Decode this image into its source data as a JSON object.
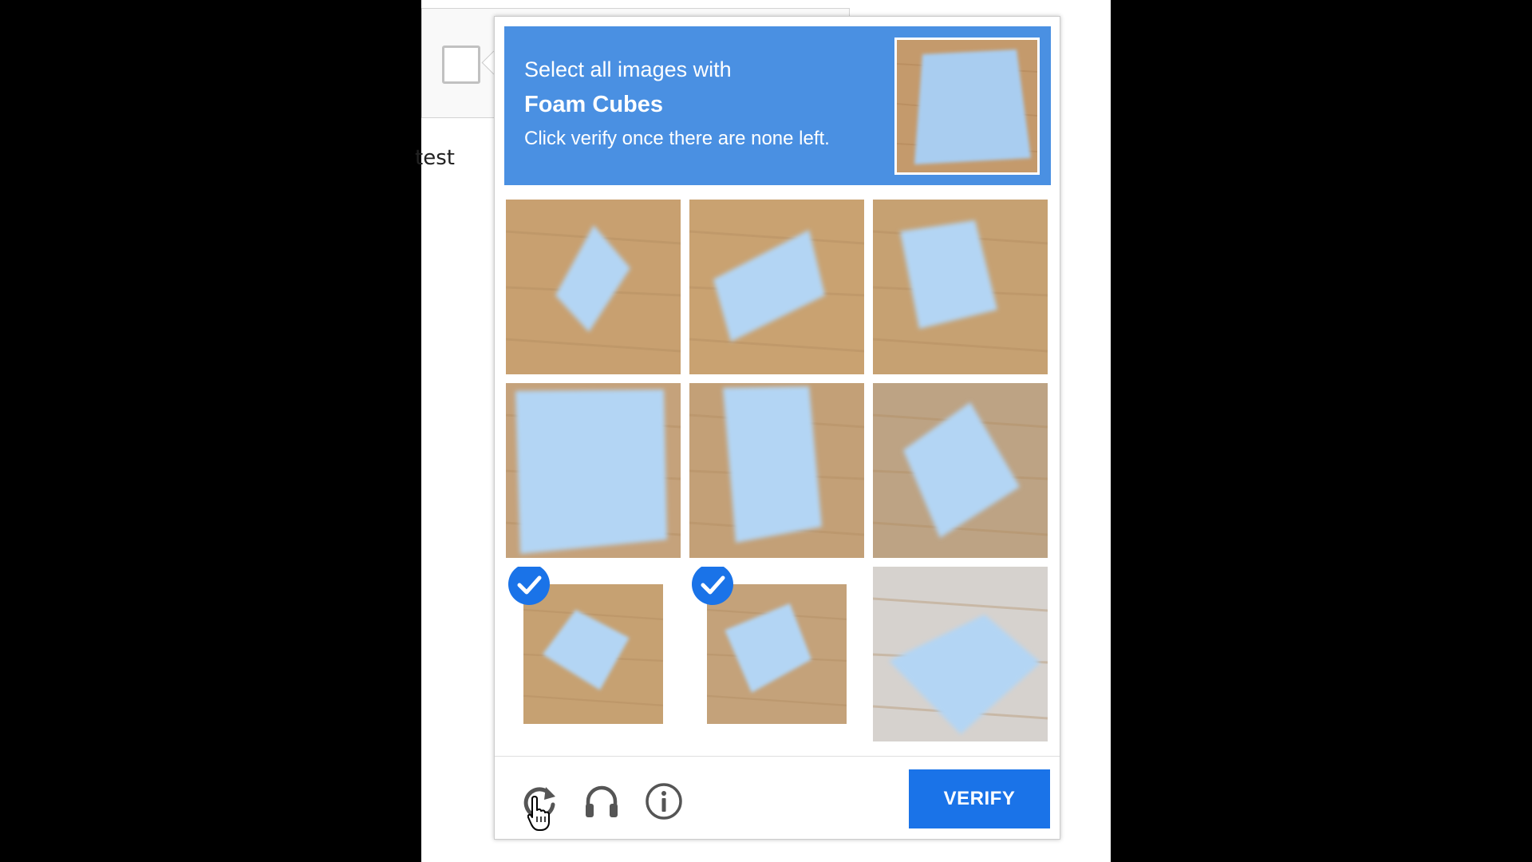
{
  "page": {
    "visible_text": "test"
  },
  "challenge": {
    "instruction_line1": "Select all images with",
    "target_object": "Foam Cubes",
    "instruction_line2": "Click verify once there are none left.",
    "header_color": "#4a90e2",
    "sample_image": "foam-cube-sample-image",
    "tiles": [
      {
        "image": "foam-cube-image",
        "selected": false
      },
      {
        "image": "foam-cube-image",
        "selected": false
      },
      {
        "image": "foam-cube-image",
        "selected": false
      },
      {
        "image": "foam-cube-image",
        "selected": false
      },
      {
        "image": "foam-cube-image",
        "selected": false
      },
      {
        "image": "foam-cube-image",
        "selected": false
      },
      {
        "image": "foam-cube-image",
        "selected": true
      },
      {
        "image": "foam-cube-image",
        "selected": true
      },
      {
        "image": "foam-cube-image",
        "selected": false
      }
    ]
  },
  "footer": {
    "icons": [
      "reload-icon",
      "headphones-icon",
      "info-icon"
    ],
    "verify_label": "VERIFY",
    "verify_color": "#1a73e8"
  }
}
